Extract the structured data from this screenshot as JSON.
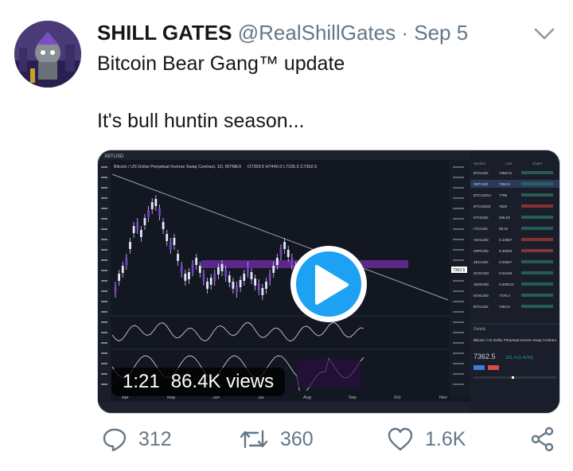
{
  "tweet": {
    "display_name": "SHILL GATES",
    "handle": "@RealShillGates",
    "separator": "·",
    "date": "Sep 5",
    "text_line1": "Bitcoin Bear Gang™ update",
    "text_line2": "It's bull huntin season..."
  },
  "video": {
    "duration": "1:21",
    "views": "86.4K views",
    "chart_title": "Bitcoin / US Dollar Perpetual Inverse Swap Contract, 1D, BITMEX",
    "ohlc": "O7259.5 H7440.0 L7235.5 C7362.5",
    "symbol": "XBTUSD",
    "price_label": "7362.5",
    "x_labels": [
      "Apr",
      "May",
      "Jun",
      "Jul",
      "Aug",
      "Sep",
      "Oct",
      "Nov"
    ],
    "panel": {
      "header_symbol": "Symbol",
      "header_last": "Last",
      "header_chg": "Chg%",
      "rows": [
        {
          "symbol": "BTCUSD",
          "last": "7368.01"
        },
        {
          "symbol": "XBTUSD",
          "last": "7362.5"
        },
        {
          "symbol": "BTCUSDU",
          "last": "7758"
        },
        {
          "symbol": "BTCUSDZ",
          "last": "7620"
        },
        {
          "symbol": "ETHUSD",
          "last": "286.03"
        },
        {
          "symbol": "LTCUSD",
          "last": "88.32"
        },
        {
          "symbol": "ADAUSD",
          "last": "0.10657"
        },
        {
          "symbol": "XRPUSD",
          "last": "0.33200"
        },
        {
          "symbol": "ZECUSD",
          "last": "0.04627"
        },
        {
          "symbol": "DCRUSD",
          "last": "0.04449"
        },
        {
          "symbol": "XEMUSD",
          "last": "0.000014"
        },
        {
          "symbol": "EOSUSD",
          "last": "7378.3"
        },
        {
          "symbol": "BTCUSD",
          "last": "7364.5"
        }
      ],
      "details_label": "Details",
      "details_name": "Bitcoin / US Dollar Perpetual Inverse Swap Contract",
      "details_price": "7362.5",
      "details_change": "101.0 (1.42%)"
    }
  },
  "actions": {
    "replies": "312",
    "retweets": "360",
    "likes": "1.6K"
  },
  "colors": {
    "accent": "#1da1f2",
    "muted": "#657786",
    "chart_bg": "#131722",
    "candle": "#e6e6ff",
    "zone": "#6a2a9a"
  }
}
